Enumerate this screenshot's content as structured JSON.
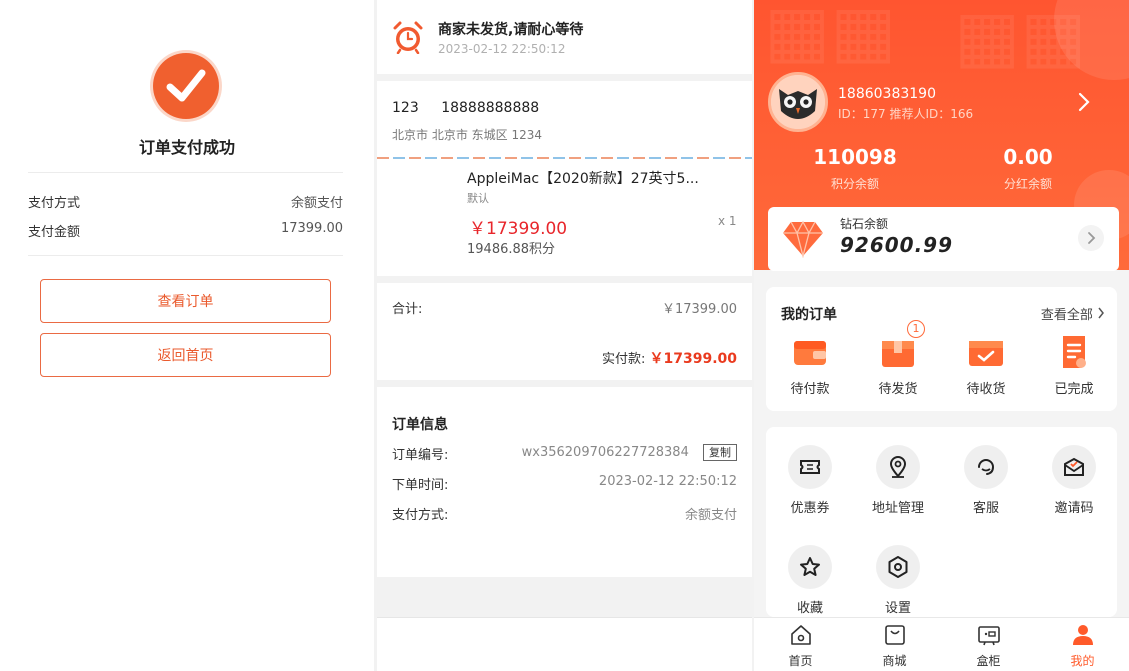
{
  "payment": {
    "title": "订单支付成功",
    "method_label": "支付方式",
    "method_value": "余额支付",
    "amount_label": "支付金额",
    "amount_value": "17399.00",
    "view_order": "查看订单",
    "back_home": "返回首页"
  },
  "order_detail": {
    "status_title": "商家未发货,请耐心等待",
    "status_time": "2023-02-12   22:50:12",
    "receiver_name": "123",
    "receiver_phone": "18888888888",
    "receiver_address": "北京市 北京市 东城区 1234",
    "product": {
      "name": "AppleiMac【2020新款】27英寸5...",
      "spec": "默认",
      "price": "￥17399.00",
      "qty": "x 1",
      "points": "19486.88积分"
    },
    "total_label": "合计:",
    "total_value": "￥17399.00",
    "paid_label": "实付款:",
    "paid_value": "￥17399.00",
    "info_title": "订单信息",
    "order_no_label": "订单编号:",
    "order_no_value": "wx356209706227728384",
    "copy_label": "复制",
    "order_time_label": "下单时间:",
    "order_time_value": "2023-02-12 22:50:12",
    "pay_method_label": "支付方式:",
    "pay_method_value": "余额支付"
  },
  "profile": {
    "phone": "18860383190",
    "id_line": "ID：177   推荐人ID：166",
    "points_value": "110098",
    "points_label": "积分余额",
    "dividend_value": "0.00",
    "dividend_label": "分红余额",
    "diamond_label": "钻石余额",
    "diamond_value": "92600.99",
    "orders_title": "我的订单",
    "orders_all": "查看全部",
    "order_tabs": [
      {
        "label": "待付款",
        "icon": "wallet-icon"
      },
      {
        "label": "待发货",
        "icon": "box-icon",
        "badge": "1"
      },
      {
        "label": "待收货",
        "icon": "truck-icon"
      },
      {
        "label": "已完成",
        "icon": "document-icon"
      }
    ],
    "tools": [
      {
        "label": "优惠券",
        "icon": "coupon-icon"
      },
      {
        "label": "地址管理",
        "icon": "location-icon"
      },
      {
        "label": "客服",
        "icon": "headset-icon"
      },
      {
        "label": "邀请码",
        "icon": "envelope-icon"
      },
      {
        "label": "收藏",
        "icon": "star-icon"
      },
      {
        "label": "设置",
        "icon": "gear-icon"
      }
    ],
    "tabbar": [
      {
        "label": "首页",
        "icon": "home-icon"
      },
      {
        "label": "商城",
        "icon": "shop-bag-icon"
      },
      {
        "label": "盒柜",
        "icon": "cabinet-icon"
      },
      {
        "label": "我的",
        "icon": "user-icon",
        "active": true
      }
    ],
    "accent": "#ff5a2a"
  }
}
